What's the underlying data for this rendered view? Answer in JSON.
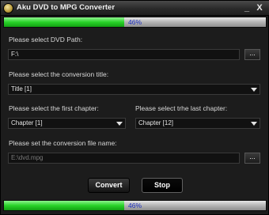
{
  "window": {
    "title": "Aku DVD to MPG Converter",
    "minimize_glyph": "_",
    "close_glyph": "X",
    "icon": "app-disc-icon"
  },
  "progress_top": {
    "label": "46%",
    "value": 0.46
  },
  "progress_bottom": {
    "label": "46%",
    "value": 0.46
  },
  "dvd_path": {
    "label": "Please select DVD Path:",
    "value": "F:\\",
    "browse_label": "..."
  },
  "conversion_title": {
    "label": "Please select the conversion title:",
    "selected": "Title [1]"
  },
  "first_chapter": {
    "label": "Please select the first chapter:",
    "selected": "Chapter [1]"
  },
  "last_chapter": {
    "label": "Please select trhe last chapter:",
    "selected": "Chapter [12]"
  },
  "output_file": {
    "label": "Please set the conversion file name:",
    "value": "E:\\dvd.mpg",
    "browse_label": "..."
  },
  "actions": {
    "convert_label": "Convert",
    "stop_label": "Stop"
  },
  "colors": {
    "progress_fill": "#29d229",
    "progress_text": "#1a2cc0",
    "background": "#1c1c1c"
  }
}
